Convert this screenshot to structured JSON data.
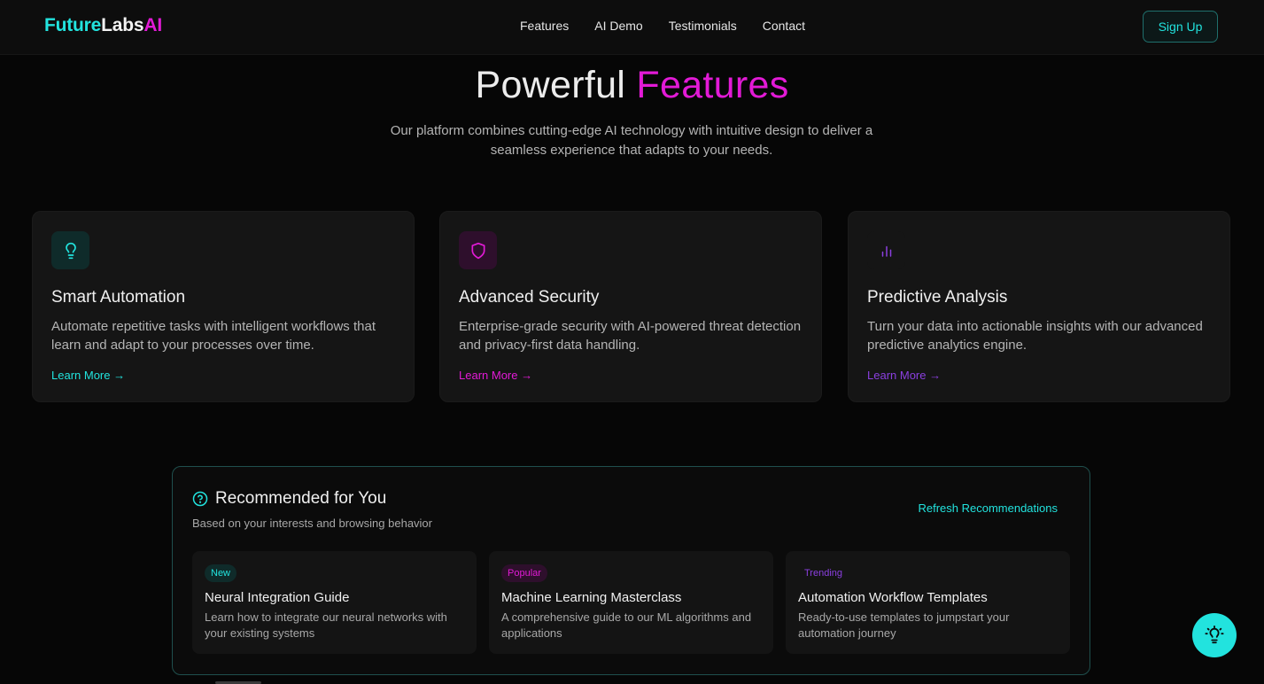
{
  "header": {
    "logo": {
      "part1": "Future",
      "part2": "Labs",
      "part3": "AI"
    },
    "nav": [
      "Features",
      "AI Demo",
      "Testimonials",
      "Contact"
    ],
    "signup": "Sign Up"
  },
  "hero": {
    "title_plain": "Powerful",
    "title_accent": "Features",
    "subtitle": "Our platform combines cutting-edge AI technology with intuitive design to deliver a seamless experience that adapts to your needs."
  },
  "features": [
    {
      "icon": "lightbulb-icon",
      "title": "Smart Automation",
      "description": "Automate repetitive tasks with intelligent workflows that learn and adapt to your processes over time.",
      "link": "Learn More →",
      "color": "#22e3de"
    },
    {
      "icon": "shield-icon",
      "title": "Advanced Security",
      "description": "Enterprise-grade security with AI-powered threat detection and privacy-first data handling.",
      "link": "Learn More →",
      "color": "#e21ad6"
    },
    {
      "icon": "bar-chart-icon",
      "title": "Predictive Analysis",
      "description": "Turn your data into actionable insights with our advanced predictive analytics engine.",
      "link": "Learn More →",
      "color": "#8b3fe0"
    }
  ],
  "recommendations": {
    "title": "Recommended for You",
    "subtitle": "Based on your interests and browsing behavior",
    "refresh": "Refresh Recommendations",
    "items": [
      {
        "badge": "New",
        "title": "Neural Integration Guide",
        "description": "Learn how to integrate our neural networks with your existing systems"
      },
      {
        "badge": "Popular",
        "title": "Machine Learning Masterclass",
        "description": "A comprehensive guide to our ML algorithms and applications"
      },
      {
        "badge": "Trending",
        "title": "Automation Workflow Templates",
        "description": "Ready-to-use templates to jumpstart your automation journey"
      }
    ]
  },
  "theme": {
    "cyan": "#22e3de",
    "magenta": "#e21ad6",
    "purple": "#8b3fe0",
    "background": "#060606"
  }
}
